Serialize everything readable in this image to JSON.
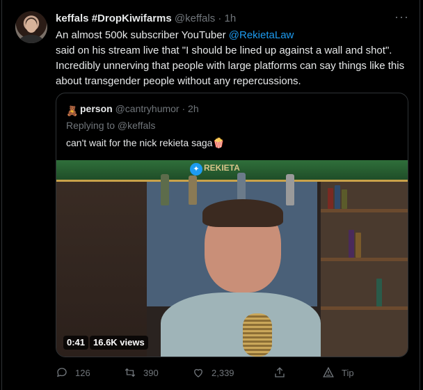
{
  "tweet": {
    "display_name": "keffals #DropKiwifarms",
    "handle": "@keffals",
    "time": "· 1h",
    "more": "···",
    "text_before": "An almost 500k subscriber YouTuber ",
    "mention": "@RekietaLaw",
    "text_after": " said on his stream live that \"I should be lined up against a wall and shot\". Incredibly unnerving that people with large platforms can say things like this about transgender people without any repercussions."
  },
  "quote": {
    "display_name": "person",
    "handle": "@cantryhumor",
    "time": "· 2h",
    "replying": "Replying to @keffals",
    "text": "can't wait for the nick rekieta saga",
    "emoji": "🍿",
    "video": {
      "banner_title": "REKIETA",
      "duration": "0:41",
      "views": "16.6K views"
    }
  },
  "actions": {
    "reply_count": "126",
    "retweet_count": "390",
    "like_count": "2,339",
    "tip_label": "Tip"
  },
  "colors": {
    "background": "#000000",
    "link": "#1d9bf0",
    "muted": "#71767b",
    "border": "#2f3336"
  }
}
